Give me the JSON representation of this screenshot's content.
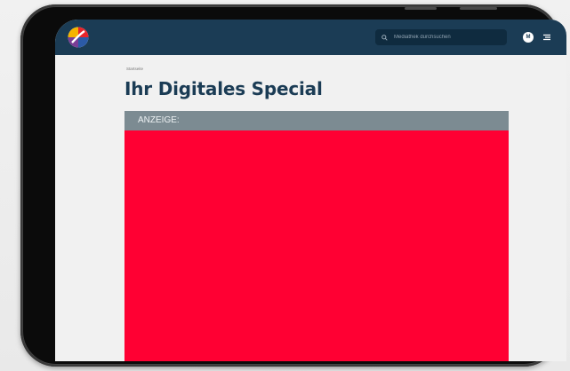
{
  "site": {
    "logo_icon": "sat1-logo-icon"
  },
  "header": {
    "search_placeholder": "Mediathek durchsuchen",
    "avatar_initial": "M",
    "menu_icon": "menu-icon",
    "search_icon": "search-icon"
  },
  "page": {
    "breadcrumb": "Startseite",
    "title": "Ihr Digitales Special"
  },
  "ad": {
    "label": "ANZEIGE:",
    "color": "#ff0033"
  },
  "colors": {
    "header_bg": "#1b3c55",
    "title": "#1b3c55",
    "ad_bar": "#7c8b92"
  }
}
